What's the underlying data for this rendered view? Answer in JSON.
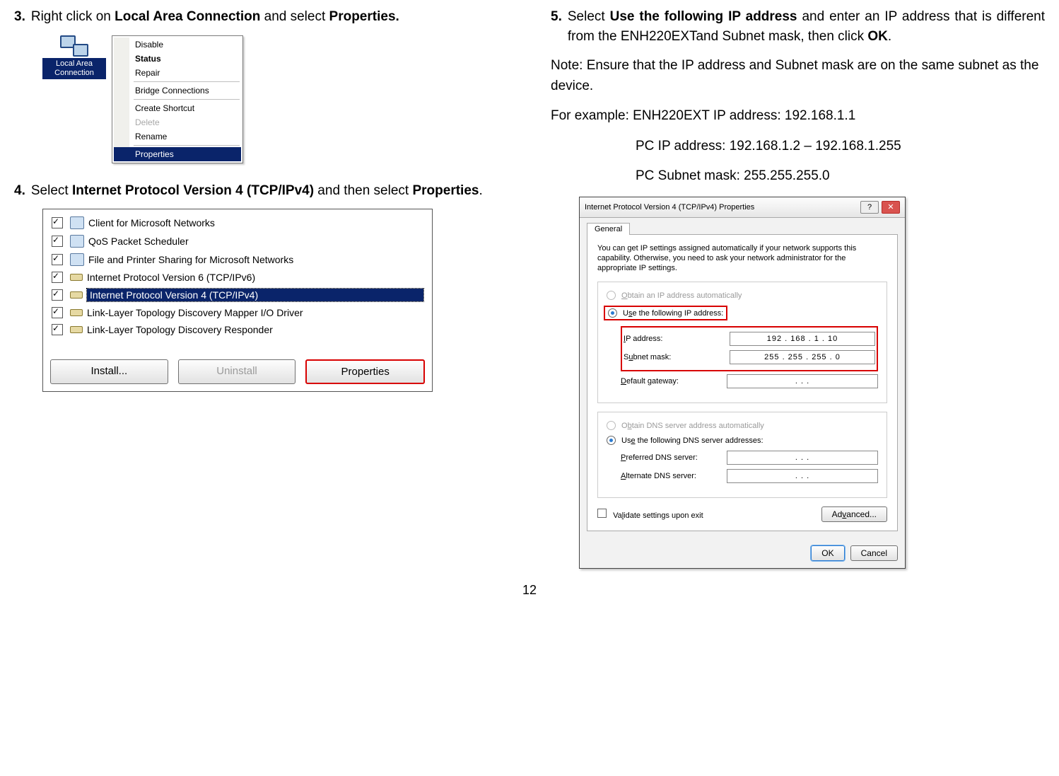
{
  "left": {
    "step3_num": "3.",
    "step3_pre": "Right click on ",
    "step3_b1": "Local Area Connection",
    "step3_mid": " and select ",
    "step3_b2": "Properties.",
    "lac_label_line1": "Local Area",
    "lac_label_line2": "Connection",
    "ctx": {
      "disable": "Disable",
      "status": "Status",
      "repair": "Repair",
      "bridge": "Bridge Connections",
      "shortcut": "Create Shortcut",
      "delete": "Delete",
      "rename": "Rename",
      "properties": "Properties"
    },
    "step4_num": "4.",
    "step4_pre": "Select ",
    "step4_b1": "Internet Protocol Version 4 (TCP/IPv4)",
    "step4_mid": " and then select ",
    "step4_b2": "Properties",
    "step4_end": ".",
    "netitems": [
      "Client for Microsoft Networks",
      "QoS Packet Scheduler",
      "File and Printer Sharing for Microsoft Networks",
      "Internet Protocol Version 6 (TCP/IPv6)",
      "Internet Protocol Version 4 (TCP/IPv4)",
      "Link-Layer Topology Discovery Mapper I/O Driver",
      "Link-Layer Topology Discovery Responder"
    ],
    "btn_install": "Install...",
    "btn_uninstall": "Uninstall",
    "btn_properties": "Properties"
  },
  "right": {
    "step5_num": "5.",
    "step5_pre": "Select ",
    "step5_b1": "Use the following IP address",
    "step5_mid": " and enter an IP address that is different from the ENH220EXTand Subnet mask, then click ",
    "step5_b2": "OK",
    "step5_end": ".",
    "note_b": "Note:",
    "note_text": " Ensure that the IP address and Subnet mask are on the same subnet as the device.",
    "example": "For example: ENH220EXT IP address: 192.168.1.1",
    "pcip": "PC IP address: 192.168.1.2 – 192.168.1.255",
    "pcsubnet": "PC Subnet mask: 255.255.255.0",
    "dlg": {
      "title": "Internet Protocol Version 4 (TCP/IPv4) Properties",
      "tab": "General",
      "intro": "You can get IP settings assigned automatically if your network supports this capability. Otherwise, you need to ask your network administrator for the appropriate IP settings.",
      "r_obtain_ip": "Obtain an IP address automatically",
      "r_use_ip": "Use the following IP address:",
      "lbl_ip": "IP address:",
      "val_ip": "192 . 168 .  1  .  10",
      "lbl_mask": "Subnet mask:",
      "val_mask": "255 . 255 . 255 .  0",
      "lbl_gw": "Default gateway:",
      "val_gw": ".      .      .",
      "r_obtain_dns": "Obtain DNS server address automatically",
      "r_use_dns": "Use the following DNS server addresses:",
      "lbl_pdns": "Preferred DNS server:",
      "lbl_adns": "Alternate DNS server:",
      "val_dns": ".      .      .",
      "chk_validate": "Validate settings upon exit",
      "btn_advanced": "Advanced...",
      "btn_ok": "OK",
      "btn_cancel": "Cancel"
    }
  },
  "page_number": "12"
}
